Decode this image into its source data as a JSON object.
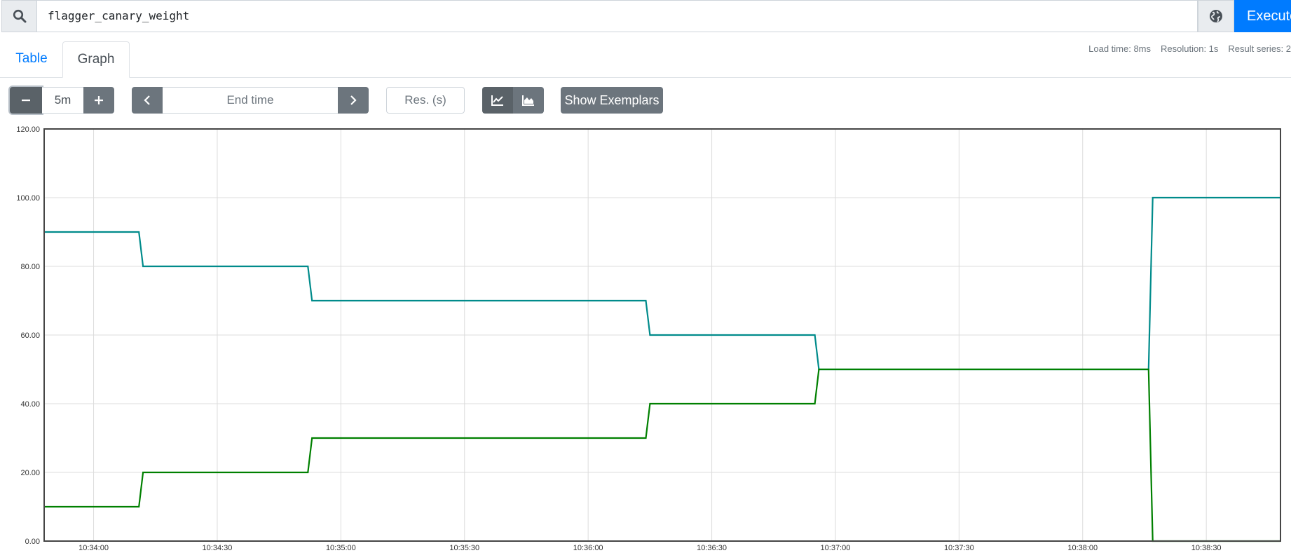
{
  "query": {
    "expression": "flagger_canary_weight",
    "execute_label": "Execute"
  },
  "tabs": [
    {
      "label": "Table"
    },
    {
      "label": "Graph"
    }
  ],
  "stats": {
    "load_time": "Load time: 8ms",
    "resolution": "Resolution: 1s",
    "result_series": "Result series: 2"
  },
  "controls": {
    "range": "5m",
    "end_time_placeholder": "End time",
    "resolution_placeholder": "Res. (s)",
    "show_exemplars_label": "Show Exemplars"
  },
  "icons": {
    "search": "search-icon",
    "globe": "globe-icon",
    "minus": "minus-icon",
    "plus": "plus-icon",
    "prev": "chevron-left-icon",
    "next": "chevron-right-icon",
    "lines": "line-chart-icon",
    "stacked": "area-chart-icon"
  },
  "colors": {
    "accent": "#007bff",
    "series_primary": "#008b8b",
    "series_canary": "#008000",
    "button_dark": "#6c757d"
  },
  "chart_data": {
    "type": "line",
    "ylim": [
      0,
      120
    ],
    "y_ticks": [
      0,
      20,
      40,
      60,
      80,
      100,
      120
    ],
    "y_tick_labels": [
      "0.00",
      "20.00",
      "40.00",
      "60.00",
      "80.00",
      "100.00",
      "120.00"
    ],
    "x_range": [
      "10:33:48",
      "10:38:48"
    ],
    "x_ticks": [
      "10:34:00",
      "10:34:30",
      "10:35:00",
      "10:35:30",
      "10:36:00",
      "10:36:30",
      "10:37:00",
      "10:37:30",
      "10:38:00",
      "10:38:30"
    ],
    "grid": true,
    "series": [
      {
        "color": "#008b8b",
        "points": [
          [
            "10:33:48",
            90
          ],
          [
            "10:34:11",
            90
          ],
          [
            "10:34:12",
            80
          ],
          [
            "10:34:52",
            80
          ],
          [
            "10:34:53",
            70
          ],
          [
            "10:36:14",
            70
          ],
          [
            "10:36:15",
            60
          ],
          [
            "10:36:55",
            60
          ],
          [
            "10:36:56",
            50
          ],
          [
            "10:38:16",
            50
          ],
          [
            "10:38:17",
            100
          ],
          [
            "10:38:48",
            100
          ]
        ]
      },
      {
        "color": "#008000",
        "points": [
          [
            "10:33:48",
            10
          ],
          [
            "10:34:11",
            10
          ],
          [
            "10:34:12",
            20
          ],
          [
            "10:34:52",
            20
          ],
          [
            "10:34:53",
            30
          ],
          [
            "10:36:14",
            30
          ],
          [
            "10:36:15",
            40
          ],
          [
            "10:36:55",
            40
          ],
          [
            "10:36:56",
            50
          ],
          [
            "10:38:16",
            50
          ],
          [
            "10:38:17",
            0
          ],
          [
            "10:38:48",
            0
          ]
        ]
      }
    ]
  }
}
